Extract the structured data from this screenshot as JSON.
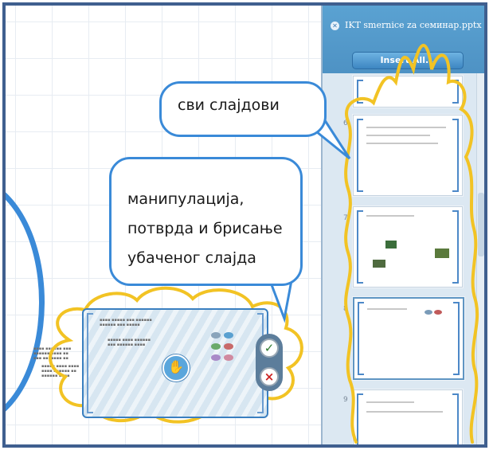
{
  "panel": {
    "title": "IKT smernice za семинар.pptx",
    "insert_all_label": "Insert All...",
    "slide_numbers": [
      "6",
      "7",
      "8",
      "9"
    ],
    "close_icon": "close-icon"
  },
  "callouts": {
    "all_slides": "сви слајдови",
    "manipulation": "манипулација,\nпотврда и брисање\nубаченог слајда"
  },
  "inserted_slide": {
    "confirm_icon": "checkmark-icon",
    "delete_icon": "x-delete-icon",
    "cursor_icon": "hand-cursor-icon"
  },
  "colors": {
    "accent": "#3a8ad8",
    "highlight_outline": "#f2c324",
    "panel_header": "#5aa2d2",
    "frame": "#3f5f8f"
  }
}
